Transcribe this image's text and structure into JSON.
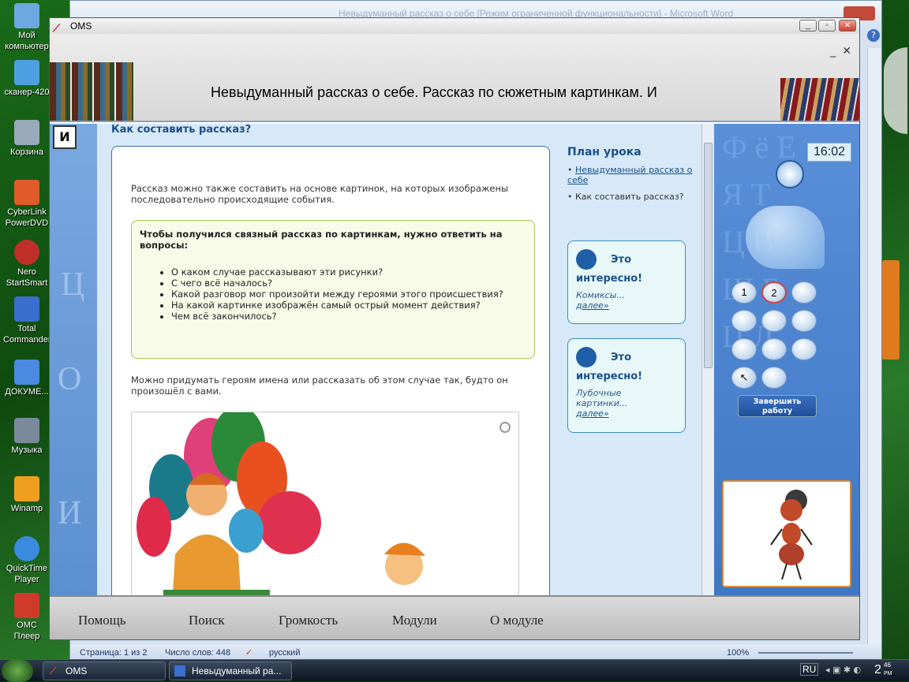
{
  "desktop": {
    "icons": [
      {
        "label": "Мой компьютер",
        "color": "#6fa8e0"
      },
      {
        "label": "сканер-420",
        "color": "#4da0e0"
      },
      {
        "label": "Корзина",
        "color": "#9ab"
      },
      {
        "label": "CyberLink PowerDVD",
        "color": "#e05a2a"
      },
      {
        "label": "Nero StartSmart",
        "color": "#c0302a"
      },
      {
        "label": "Total Commander",
        "color": "#3a6fd0"
      },
      {
        "label": "ДОКУМЕ...",
        "color": "#4a8ae0"
      },
      {
        "label": "Музыка",
        "color": "#7a8a9a"
      },
      {
        "label": "Winamp",
        "color": "#f0a020"
      },
      {
        "label": "QuickTime Player",
        "color": "#3a8ae0"
      },
      {
        "label": "ОМС Плеер",
        "color": "#d03a2a"
      }
    ]
  },
  "word": {
    "title": "Невыдуманный рассказ о себе [Режим ограниченной функциональности] - Microsoft Word",
    "status": {
      "page": "Страница: 1 из 2",
      "words": "Число слов: 448",
      "language": "русский",
      "zoom": "100%"
    }
  },
  "oms": {
    "title": "OMS",
    "header_text": "Невыдуманный рассказ о себе. Рассказ по сюжетным картинкам. И",
    "badge": "И",
    "content": {
      "title": "Как составить рассказ?",
      "intro": "Рассказ можно также составить на основе картинок, на которых изображены последовательно происходящие события.",
      "highlight_head": "Чтобы получился связный рассказ по картинкам, нужно ответить на вопросы:",
      "questions": [
        "О каком случае рассказывают эти рисунки?",
        "С чего всё началось?",
        "Какой разговор мог произойти между героями этого происшествия?",
        "На какой картинке изображён самый острый момент действия?",
        "Чем всё закончилось?"
      ],
      "outro": "Можно придумать героям имена или рассказать об этом случае так, будто он произошёл с вами."
    },
    "plan": {
      "title": "План урока",
      "items": [
        {
          "label": "Невыдуманный рассказ о себе",
          "link": true
        },
        {
          "label": "Как составить рассказ?",
          "link": false
        }
      ]
    },
    "cards": [
      {
        "title1": "Это",
        "title2": "интересно!",
        "desc": "Комиксы...",
        "more": "далее»"
      },
      {
        "title1": "Это",
        "title2": "интересно!",
        "desc": "Лубочные картинки...",
        "more": "далее»"
      }
    ],
    "panel": {
      "clock": "16:02",
      "pads": [
        "1",
        "2"
      ],
      "finish": "Завершить работу"
    },
    "footer": {
      "help": "Помощь",
      "search": "Поиск",
      "volume": "Громкость",
      "modules": "Модули",
      "about": "О модуле"
    }
  },
  "taskbar": {
    "items": [
      {
        "label": "OMS"
      },
      {
        "label": "Невыдуманный ра..."
      }
    ],
    "lang": "RU",
    "time": "2:46",
    "ampm": "PM"
  }
}
